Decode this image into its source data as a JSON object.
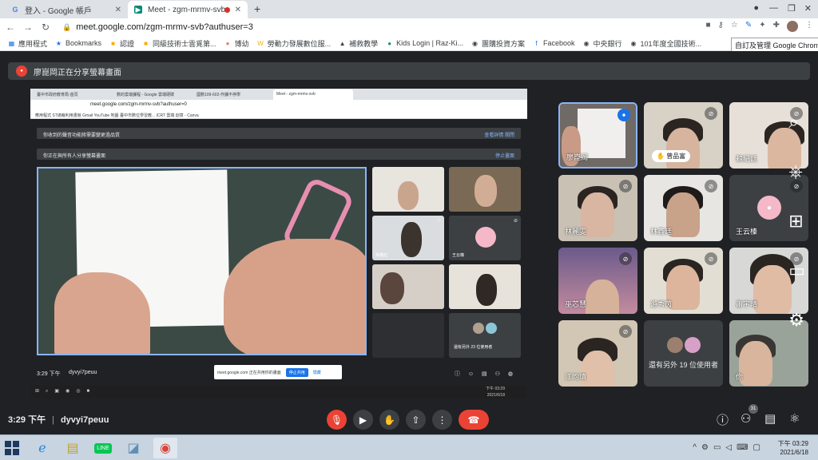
{
  "browser": {
    "tabs": [
      {
        "title": "登入 - Google 帳戶",
        "icon": "G"
      },
      {
        "title": "Meet - zgm-mrmv-svb",
        "icon": "M"
      }
    ],
    "url": "meet.google.com/zgm-mrmv-svb?authuser=3",
    "bookmarks": [
      "應用程式",
      "Bookmarks",
      "認證",
      "同級技術士雲覓第...",
      "博幼",
      "勞動力發展數位服...",
      "補救教學",
      "Kids Login | Raz-Ki...",
      "團購投資方案",
      "Facebook",
      "中央銀行",
      "101年度全國技術..."
    ],
    "tooltip": "自訂及管理 Google Chrome"
  },
  "meet": {
    "presenting_banner": "廖崑岡正在分享螢幕畫面",
    "shared_screen": {
      "tabs": [
        "臺中市政府教育局-首頁",
        "數的雲端課程 - Google 雲端硬碟",
        "國數109-602-作課不停學",
        "Meet - zgm-mrmv-svb"
      ],
      "url": "meet.google.com/zgm-mrmv-svb?authuser=0",
      "bookmarks": "應用程式   ST總裁利用書館   Gmail   YouTube   地圖   臺中市數位學習教...   ICRT   雲端   創意 - Canva",
      "notice": "你收到的聲音功能將需要變更過品質",
      "notice_actions": "查看詳情     關閉",
      "presenting": "你正在與所有人分享螢幕畫面",
      "stop": "停止畫面",
      "tiles": [
        "",
        "",
        "林鑫廷",
        "王云榛",
        "",
        "",
        "",
        "還有另外 23 位使用者"
      ],
      "time": "3:29 下午",
      "code": "dyvyi7peuu",
      "popup_text": "meet.google.com 正在共用你的畫面",
      "popup_stop": "停止共用",
      "popup_hide": "隱藏",
      "taskbar_time": "下午 03:29",
      "taskbar_date": "2021/6/18"
    },
    "participants": [
      {
        "name": "廖崑岡",
        "active": true
      },
      {
        "name": "",
        "chip": "曾品富"
      },
      {
        "name": "賴紀廷"
      },
      {
        "name": "林麗雯"
      },
      {
        "name": "林鑫廷"
      },
      {
        "name": "王云榛"
      },
      {
        "name": "巫芯慧"
      },
      {
        "name": "游秀茵"
      },
      {
        "name": "蕭宇晴"
      },
      {
        "name": "江昀瑱"
      },
      {
        "name": "還有另外 19 位使用者"
      },
      {
        "name": "你"
      }
    ],
    "controls": {
      "time": "3:29 下午",
      "meeting_code": "dyvyi7peuu",
      "people_count": "31"
    }
  },
  "taskbar": {
    "time": "下午 03:29",
    "date": "2021/6/18"
  }
}
